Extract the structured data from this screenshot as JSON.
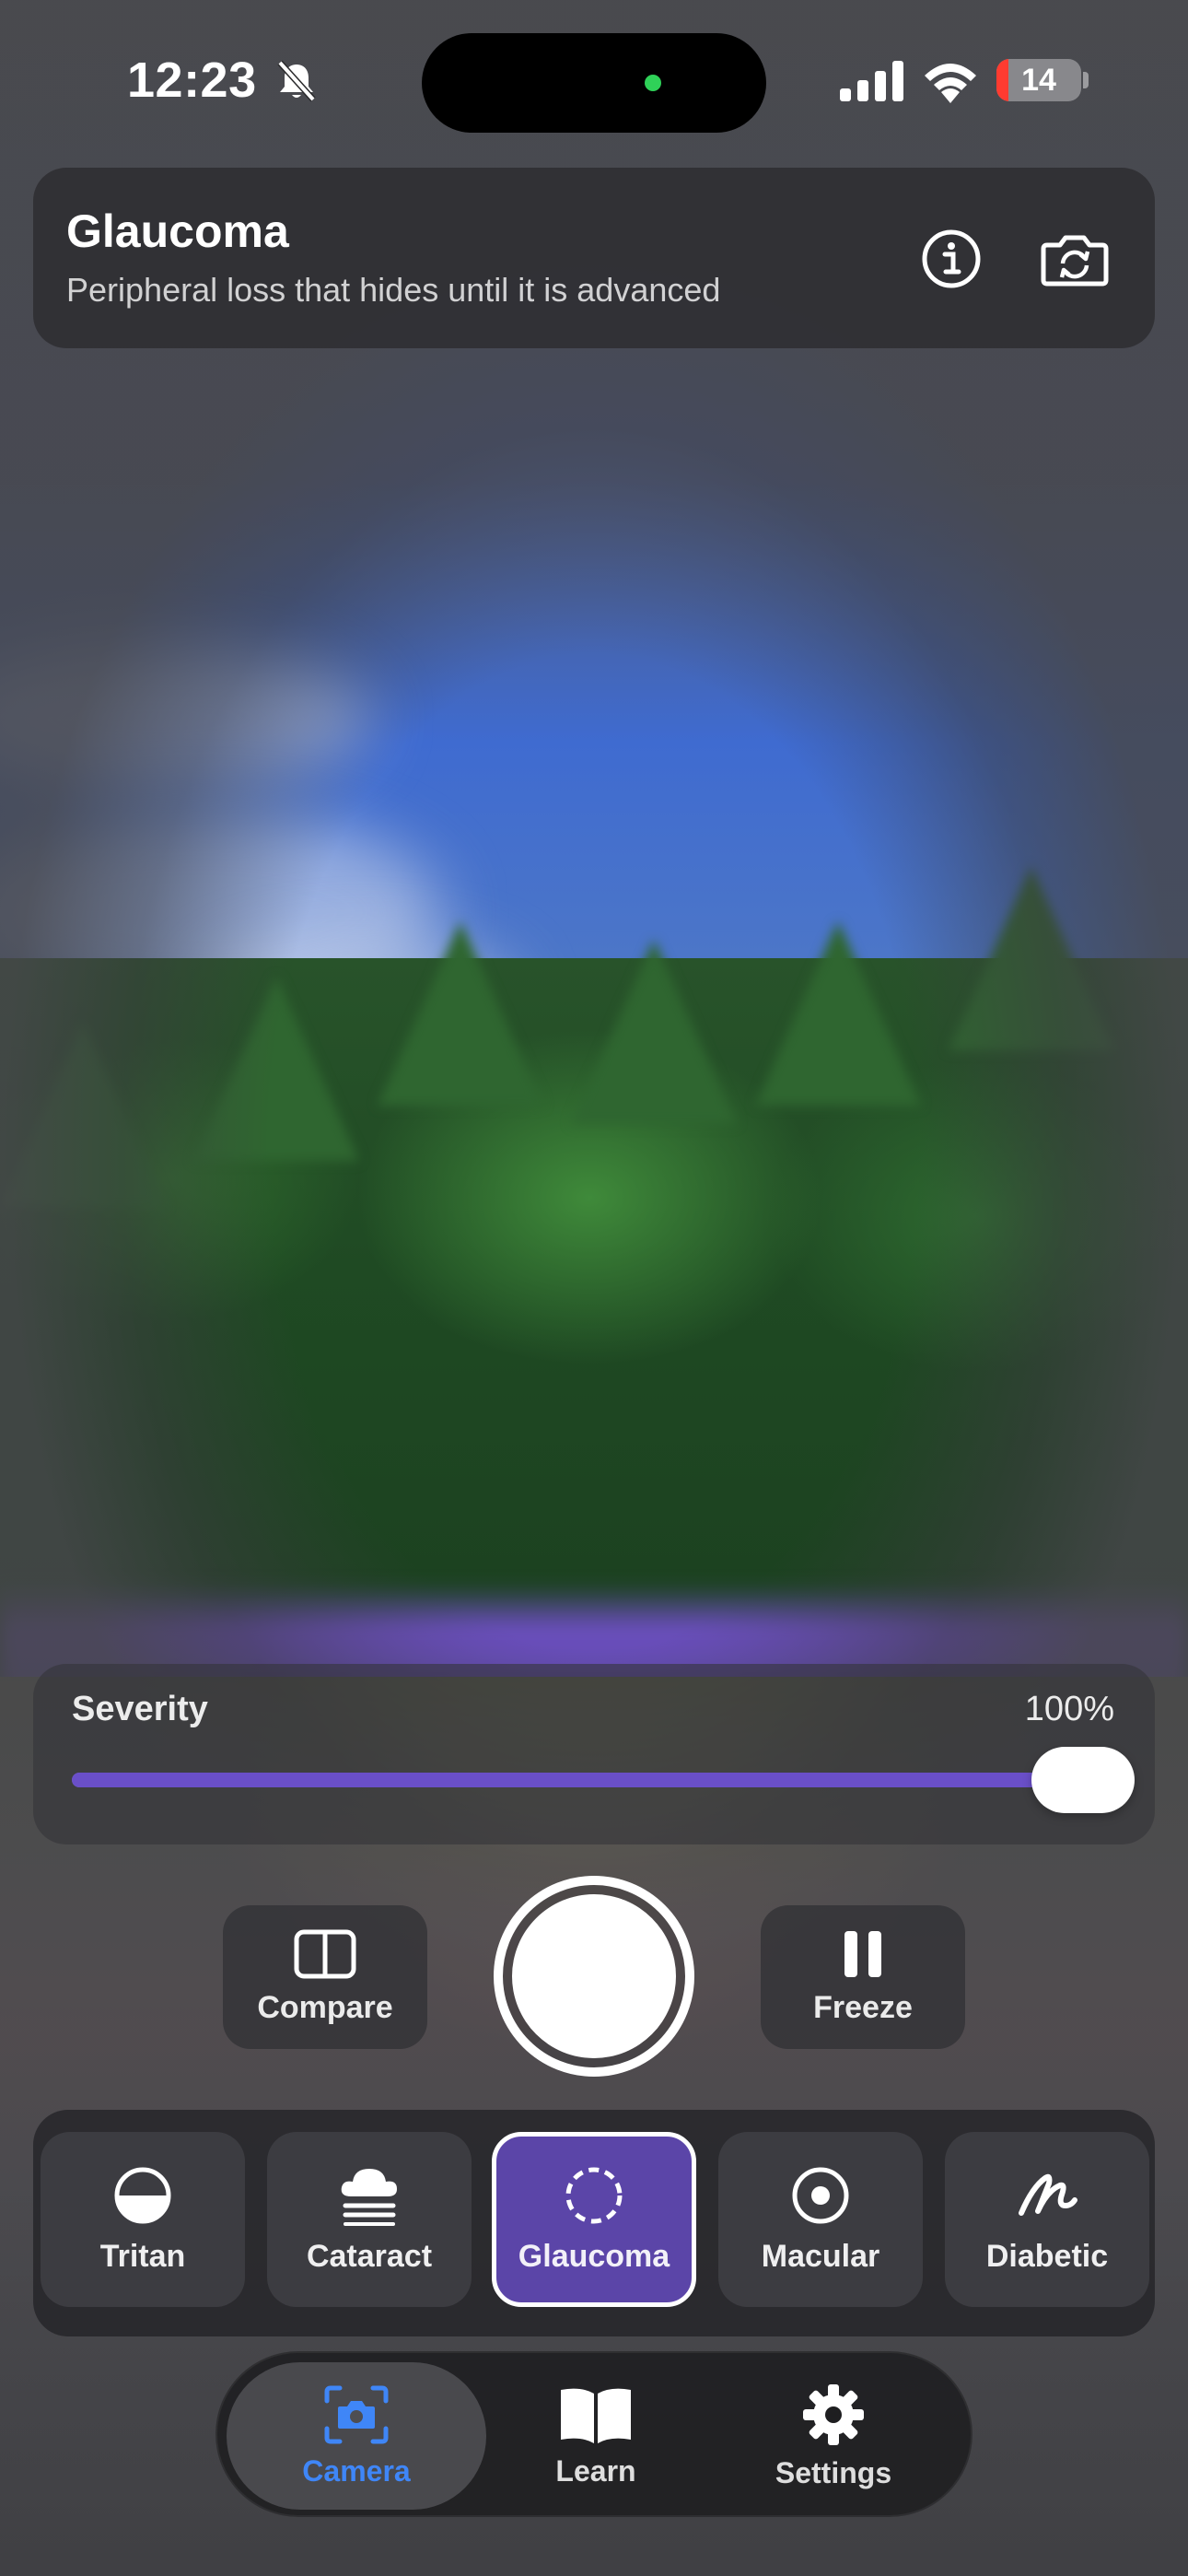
{
  "status_bar": {
    "time": "12:23",
    "battery": "14",
    "battery_level": 0.14,
    "icons": [
      "bell-slash-icon",
      "cellular-signal-icon",
      "wifi-icon",
      "battery-icon"
    ]
  },
  "header": {
    "title": "Glaucoma",
    "subtitle": "Peripheral loss that hides until it is advanced",
    "icons": [
      "info-icon",
      "camera-flip-icon"
    ]
  },
  "severity": {
    "label": "Severity",
    "value_text": "100%",
    "value": 1.0
  },
  "controls": {
    "compare_label": "Compare",
    "freeze_label": "Freeze"
  },
  "filters": {
    "items": [
      {
        "label": "Tritan",
        "icon": "half-circle-icon"
      },
      {
        "label": "Cataract",
        "icon": "cloud-fog-icon"
      },
      {
        "label": "Glaucoma",
        "icon": "dashed-circle-icon",
        "selected": true
      },
      {
        "label": "Macular",
        "icon": "target-circle-icon"
      },
      {
        "label": "Diabetic",
        "icon": "scribble-icon"
      }
    ]
  },
  "tabs": {
    "items": [
      {
        "label": "Camera",
        "icon": "camera-viewfinder-icon",
        "active": true
      },
      {
        "label": "Learn",
        "icon": "book-icon"
      },
      {
        "label": "Settings",
        "icon": "gear-icon"
      }
    ]
  },
  "colors": {
    "accent_purple": "#5b45a8",
    "slider_fill": "#6a4fc8",
    "tab_active_blue": "#3f86f7",
    "battery_low_red": "#ff3b30"
  }
}
